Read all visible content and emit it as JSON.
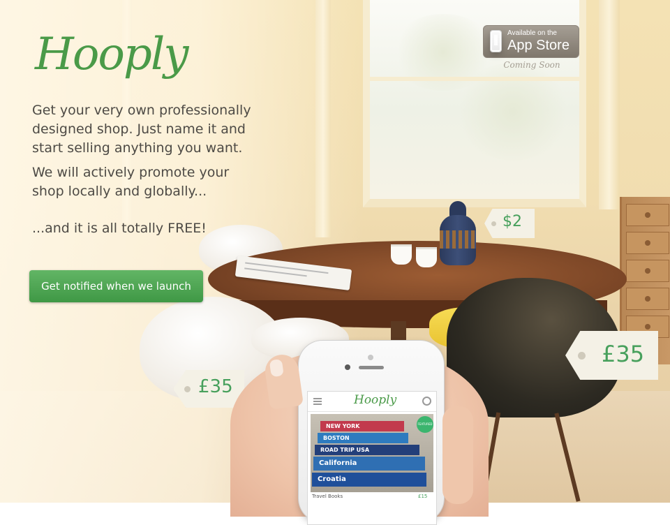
{
  "brand": {
    "logo_text": "Hooply"
  },
  "hero": {
    "paragraph1": "Get your very own professionally designed shop. Just name it and start selling anything you want.",
    "paragraph2": "We will actively promote your shop locally and globally...",
    "paragraph3": "...and it is all totally FREE!",
    "cta_label": "Get notified when we launch"
  },
  "app_store": {
    "line1": "Available on the",
    "line2": "App Store",
    "status": "Coming Soon"
  },
  "price_tags": [
    {
      "label": "$2"
    },
    {
      "label": "£35"
    },
    {
      "label": "£35"
    }
  ],
  "phone": {
    "logo_text": "Hooply",
    "badge": "FEATURED",
    "books": [
      "NEW YORK",
      "BOSTON",
      "ROAD TRIP USA",
      "California",
      "Croatia"
    ],
    "caption": "Travel Books",
    "price": "£15"
  },
  "colors": {
    "brand_green": "#4a9a48",
    "cta_green": "#4fa653",
    "tag_text": "#47a05c"
  }
}
